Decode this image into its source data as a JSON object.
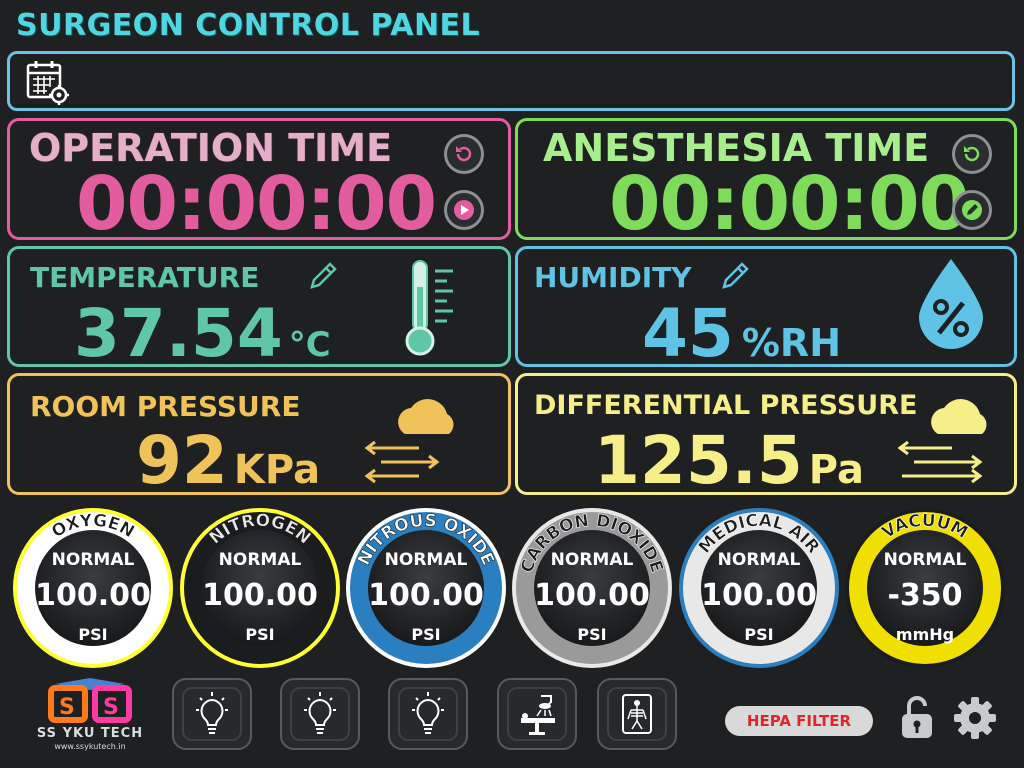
{
  "header": {
    "title": "SURGEON CONTROL PANEL"
  },
  "operation": {
    "title": "OPERATION TIME",
    "time": "00:00:00",
    "color": "#e35d9e"
  },
  "anesthesia": {
    "title": "ANESTHESIA TIME",
    "time": "00:00:00",
    "color": "#7fdc5a"
  },
  "temperature": {
    "title": "TEMPERATURE",
    "value": "37.54",
    "unit": "°C",
    "color": "#5fc7a6"
  },
  "humidity": {
    "title": "HUMIDITY",
    "value": "45",
    "unit": "%RH",
    "color": "#5ec3e4"
  },
  "room_pressure": {
    "title": "ROOM PRESSURE",
    "value": "92",
    "unit": "KPa",
    "color": "#f0c35a"
  },
  "differential_pressure": {
    "title": "DIFFERENTIAL PRESSURE",
    "value": "125.5",
    "unit": "Pa",
    "color": "#f6ee88"
  },
  "gases": [
    {
      "name": "OXYGEN",
      "status": "NORMAL",
      "value": "100.00",
      "unit": "PSI",
      "ring": "#ffffff",
      "accent": "#ffff33"
    },
    {
      "name": "NITROGEN",
      "status": "NORMAL",
      "value": "100.00",
      "unit": "PSI",
      "ring": "#1a1c1e",
      "accent": "#ffff33"
    },
    {
      "name": "NITROUS OXIDE",
      "status": "NORMAL",
      "value": "100.00",
      "unit": "PSI",
      "ring": "#2a7fc0",
      "accent": "#ffffff"
    },
    {
      "name": "CARBON DIOXIDE",
      "status": "NORMAL",
      "value": "100.00",
      "unit": "PSI",
      "ring": "#9a9a9a",
      "accent": "#e8e8e8"
    },
    {
      "name": "MEDICAL AIR",
      "status": "NORMAL",
      "value": "100.00",
      "unit": "PSI",
      "ring": "#e8e8e8",
      "accent": "#2a7fc0"
    },
    {
      "name": "VACUUM",
      "status": "NORMAL",
      "value": "-350",
      "unit": "mmHg",
      "ring": "#f0e000",
      "accent": "#1a1c1e"
    }
  ],
  "logo": {
    "name": "SS YKU TECH",
    "url": "www.ssykutech.in"
  },
  "footer": {
    "hepa_label": "HEPA FILTER"
  },
  "icons": {
    "calendar": "calendar-settings-icon",
    "reset": "reset-icon",
    "play": "play-icon",
    "edit": "pencil-icon",
    "thermometer": "thermometer-icon",
    "humidity": "humidity-drop-icon",
    "pressure": "wind-cloud-icon",
    "light": "light-bulb-icon",
    "or_light": "surgical-lamp-icon",
    "xray": "xray-viewer-icon",
    "lock": "lock-icon",
    "settings": "gear-icon"
  }
}
